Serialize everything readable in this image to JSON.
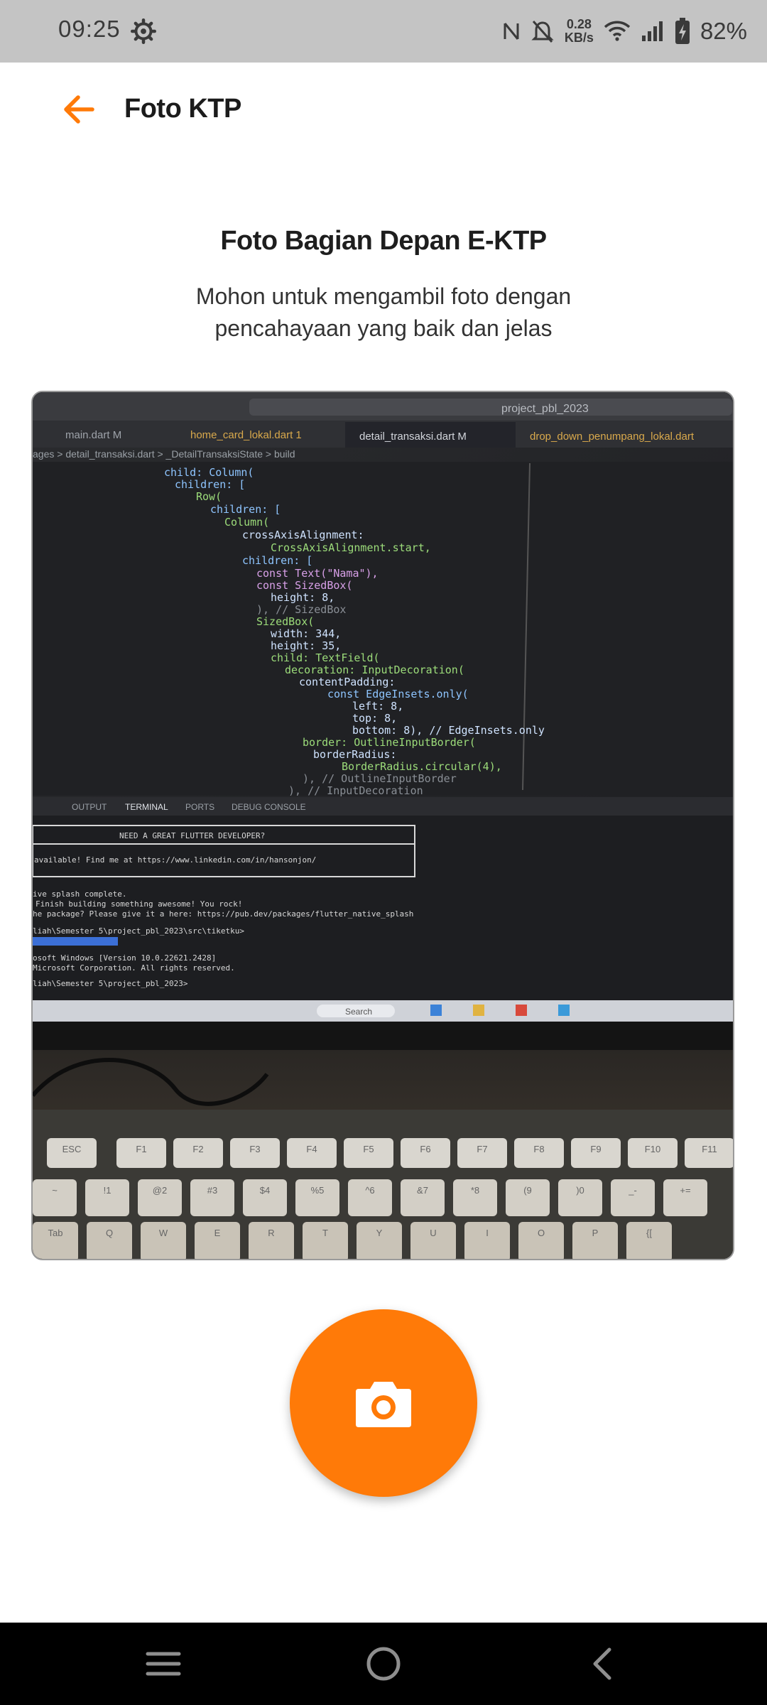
{
  "status_bar": {
    "time": "09:25",
    "speed_value": "0.28",
    "speed_unit": "KB/s",
    "battery": "82%",
    "icons": [
      "gear-icon",
      "nfc-icon",
      "bell-off-icon",
      "wifi-icon",
      "signal-icon",
      "battery-charging-icon"
    ]
  },
  "app_bar": {
    "title": "Foto KTP",
    "back_icon": "arrow-left-icon"
  },
  "instructions": {
    "heading": "Foto Bagian Depan E-KTP",
    "subtext": "Mohon untuk mengambil foto dengan pencahayaan yang baik dan jelas"
  },
  "photo": {
    "editor_search": "project_pbl_2023",
    "tabs": [
      "main.dart M",
      "home_card_lokal.dart 1",
      "detail_transaksi.dart M",
      "drop_down_penumpang_lokal.dart"
    ],
    "breadcrumb": "ages > detail_transaksi.dart > _DetailTransaksiState > build",
    "code_lines": [
      "child: Column(",
      "children: [",
      "Row(",
      "children: [",
      "Column(",
      "crossAxisAlignment:",
      "CrossAxisAlignment.start,",
      "children: [",
      "const Text(\"Nama\"),",
      "const SizedBox(",
      "height: 8,",
      "), // SizedBox",
      "SizedBox(",
      "width: 344,",
      "height: 35,",
      "child: TextField(",
      "decoration: InputDecoration(",
      "contentPadding:",
      "const EdgeInsets.only(",
      "left: 8,",
      "top: 8,",
      "bottom: 8), // EdgeInsets.only",
      "border: OutlineInputBorder(",
      "borderRadius:",
      "BorderRadius.circular(4),",
      "), // OutlineInputBorder",
      "), // InputDecoration"
    ],
    "panel_tabs": [
      "OUTPUT",
      "TERMINAL",
      "PORTS",
      "DEBUG CONSOLE"
    ],
    "terminal_box_title": "NEED A GREAT FLUTTER DEVELOPER?",
    "terminal_box_line": "available!  Find me at https://www.linkedin.com/in/hansonjon/",
    "terminal_lines": [
      "ive splash complete.",
      "Finish building something awesome! You rock!",
      "he package? Please give it a  here: https://pub.dev/packages/flutter_native_splash",
      "liah\\Semester 5\\project_pbl_2023\\src\\tiketku>",
      "osoft Windows [Version 10.0.22621.2428]",
      "Microsoft Corporation. All rights reserved.",
      "liah\\Semester 5\\project_pbl_2023>"
    ],
    "taskbar_search": "Search",
    "keys_row1": [
      "ESC",
      "F1",
      "F2",
      "F3",
      "F4",
      "F5",
      "F6",
      "F7",
      "F8",
      "F9",
      "F10",
      "F11"
    ],
    "keys_row2": [
      "~",
      "!1",
      "@2",
      "#3",
      "$4",
      "%5",
      "^6",
      "&7",
      "*8",
      "(9",
      ")0",
      "_-",
      "+="
    ],
    "keys_row3": [
      "Tab",
      "Q",
      "W",
      "E",
      "R",
      "T",
      "Y",
      "U",
      "I",
      "O",
      "P",
      "{["
    ]
  },
  "capture": {
    "icon": "camera-icon"
  },
  "nav_bar": {
    "icons": [
      "menu-icon",
      "home-icon",
      "back-icon"
    ]
  },
  "colors": {
    "accent": "#ff7a08",
    "status_bar_bg": "#c4c4c4",
    "nav_bar_bg": "#000000"
  }
}
